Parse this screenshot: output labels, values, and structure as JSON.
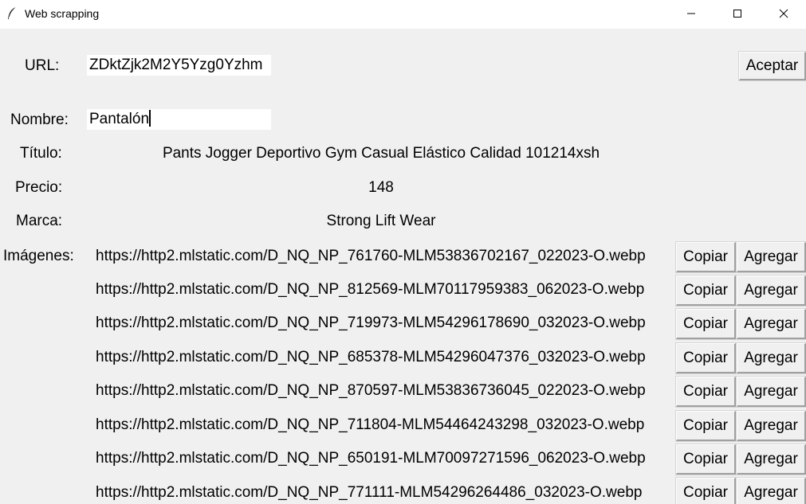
{
  "window": {
    "title": "Web scrapping",
    "icon": "feather-icon"
  },
  "form": {
    "url_label": "URL:",
    "url_value": "ZDktZjk2M2Y5Yzg0Yzhm",
    "accept_label": "Aceptar",
    "name_label": "Nombre:",
    "name_value": "Pantalón"
  },
  "details": {
    "title_label": "Título:",
    "title_value": "Pants Jogger Deportivo Gym Casual Elástico Calidad 101214xsh",
    "price_label": "Precio:",
    "price_value": "148",
    "brand_label": "Marca:",
    "brand_value": "Strong Lift Wear"
  },
  "images": {
    "label": "Imágenes:",
    "copy_label": "Copiar",
    "add_label": "Agregar",
    "urls": [
      "https://http2.mlstatic.com/D_NQ_NP_761760-MLM53836702167_022023-O.webp",
      "https://http2.mlstatic.com/D_NQ_NP_812569-MLM70117959383_062023-O.webp",
      "https://http2.mlstatic.com/D_NQ_NP_719973-MLM54296178690_032023-O.webp",
      "https://http2.mlstatic.com/D_NQ_NP_685378-MLM54296047376_032023-O.webp",
      "https://http2.mlstatic.com/D_NQ_NP_870597-MLM53836736045_022023-O.webp",
      "https://http2.mlstatic.com/D_NQ_NP_711804-MLM54464243298_032023-O.webp",
      "https://http2.mlstatic.com/D_NQ_NP_650191-MLM70097271596_062023-O.webp",
      "https://http2.mlstatic.com/D_NQ_NP_771111-MLM54296264486_032023-O.webp"
    ]
  }
}
